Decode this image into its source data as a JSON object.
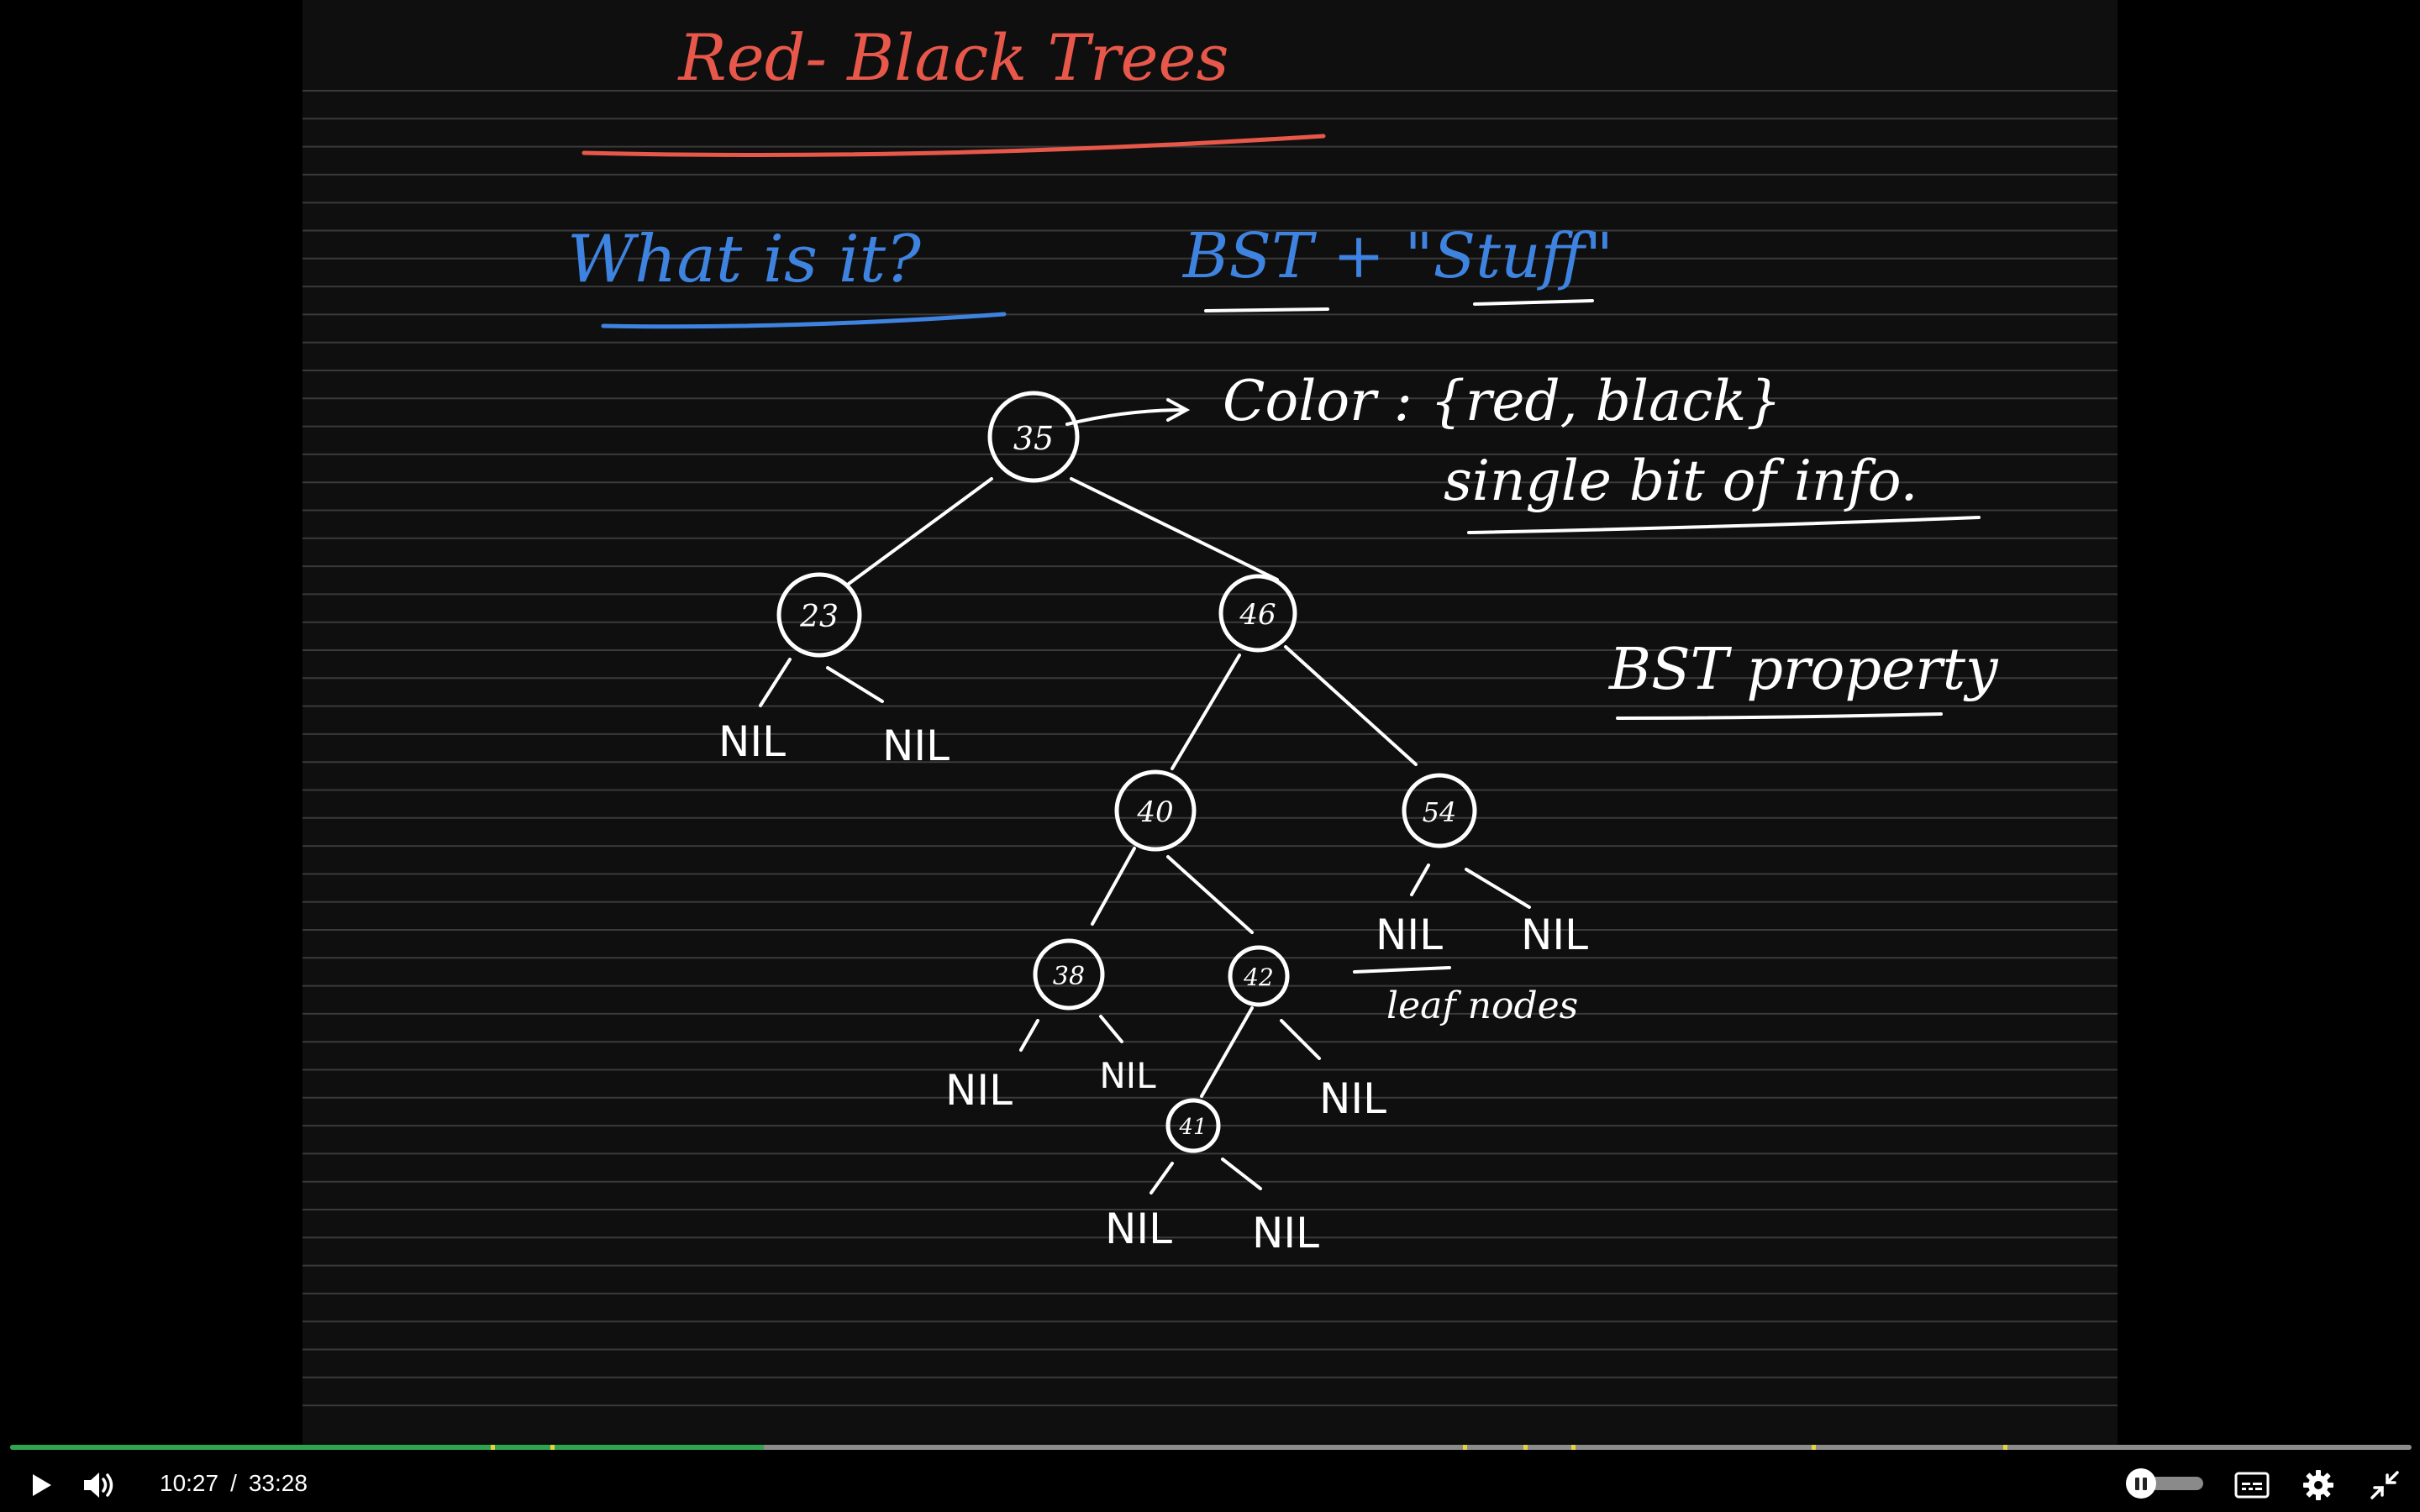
{
  "player": {
    "current_time": "10:27",
    "separator": "/",
    "duration": "33:28",
    "progress_fraction": 0.314,
    "markers": [
      0.2,
      0.225,
      0.605,
      0.63,
      0.65,
      0.75,
      0.83
    ],
    "accent_color": "#2fa44f",
    "icons": [
      "play-icon",
      "volume-icon",
      "pause-toggle-icon",
      "captions-icon",
      "settings-gear-icon",
      "exit-fullscreen-icon"
    ]
  },
  "board": {
    "background": "#0e0e0e",
    "title": "Red- Black Trees",
    "question": "What is it?",
    "answer": "BST + \"Stuff\"",
    "color_note": "Color : {red, black}",
    "bit_note": "single bit of info.",
    "property_note": "BST property",
    "leaf_note": "leaf nodes",
    "colors": {
      "title": "#e8584a",
      "blue": "#3f83e0",
      "ink": "#ffffff"
    },
    "tree": {
      "nodes": [
        "35",
        "23",
        "46",
        "40",
        "54",
        "38",
        "42",
        "41"
      ],
      "nil_label": "NIL"
    }
  }
}
